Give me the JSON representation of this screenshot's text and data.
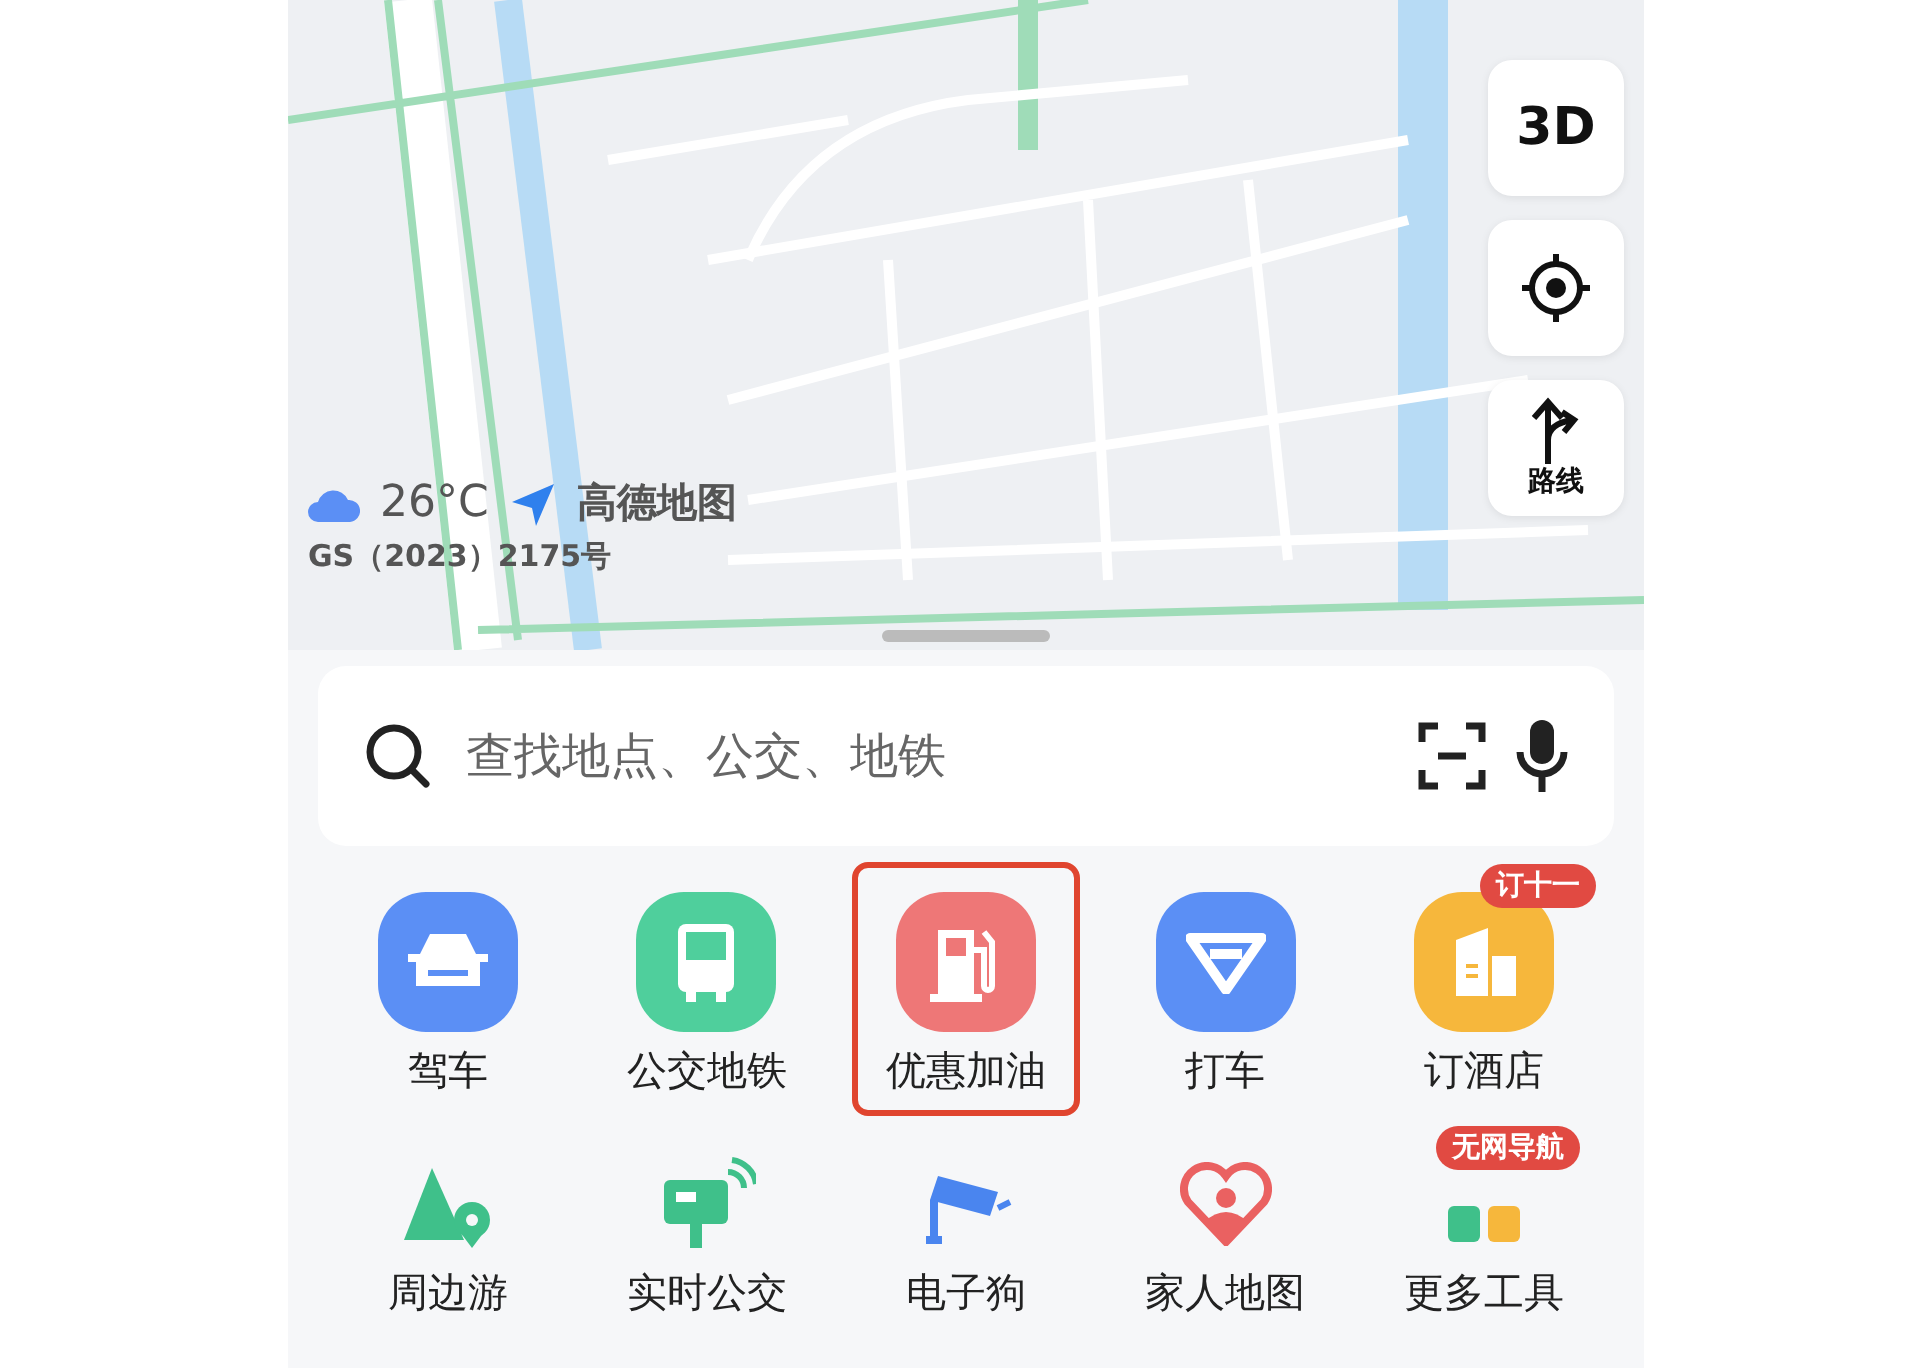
{
  "map": {
    "kind": "picture",
    "weather": {
      "temperature": "26°C"
    },
    "logo": "高德地图",
    "license": "GS（2023）2175号",
    "controls": [
      {
        "kind": "text",
        "label": "3D"
      },
      {
        "kind": "locate"
      },
      {
        "kind": "route",
        "label": "路线"
      }
    ]
  },
  "search": {
    "placeholder": "查找地点、公交、地铁"
  },
  "tools": [
    {
      "label": "驾车",
      "kind": "car",
      "color": "#5b8ff5",
      "highlighted": false
    },
    {
      "label": "公交地铁",
      "kind": "bus",
      "color": "#4fcf9c",
      "highlighted": false
    },
    {
      "label": "优惠加油",
      "kind": "fuel",
      "color": "#ee7777",
      "highlighted": true
    },
    {
      "label": "打车",
      "kind": "taxi",
      "color": "#5b8ff5",
      "highlighted": false
    },
    {
      "label": "订酒店",
      "kind": "hotel",
      "color": "#f6b73c",
      "highlighted": false,
      "badge": "订十一"
    }
  ],
  "more_tools": [
    {
      "label": "周边游",
      "kind": "mountain"
    },
    {
      "label": "实时公交",
      "kind": "stop"
    },
    {
      "label": "电子狗",
      "kind": "camera"
    },
    {
      "label": "家人地图",
      "kind": "heart"
    },
    {
      "label": "更多工具",
      "kind": "grid",
      "badge": "无网导航"
    }
  ]
}
